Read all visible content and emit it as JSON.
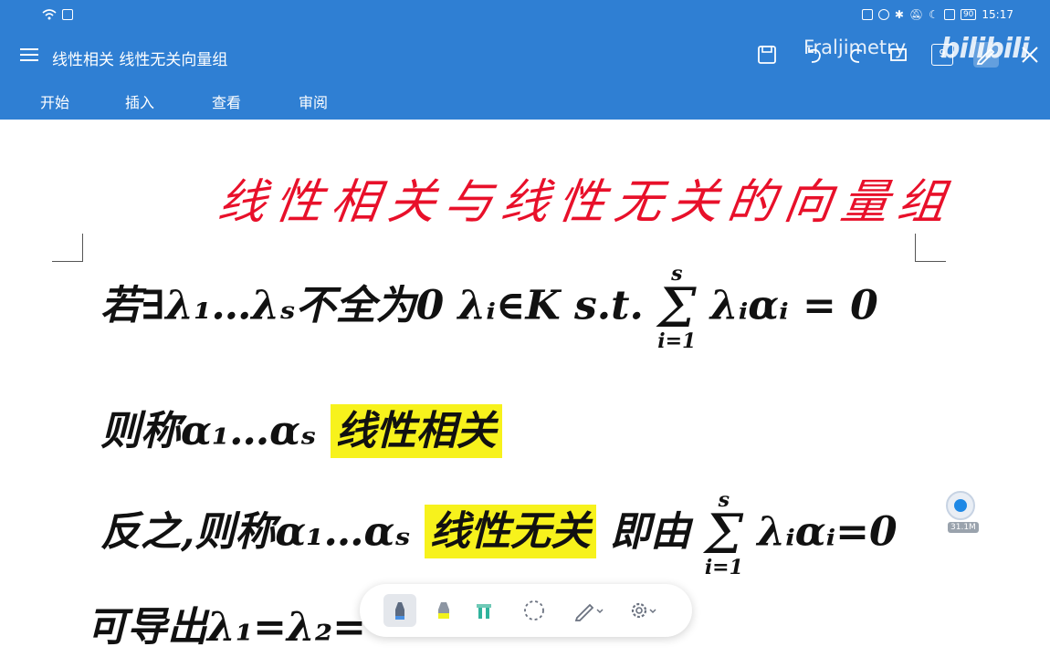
{
  "status_bar": {
    "time": "15:17",
    "battery": "90"
  },
  "title_bar": {
    "document_title": "线性相关 线性无关向量组",
    "page_count": "9",
    "watermark": "Fraljimetry",
    "watermark_logo": "bilibili"
  },
  "tabs": [
    {
      "label": "开始"
    },
    {
      "label": "插入"
    },
    {
      "label": "查看"
    },
    {
      "label": "审阅"
    }
  ],
  "notes": {
    "title": "线性相关与线性无关的向量组",
    "line1": {
      "text": "若∃λ₁…λₛ不全为0 λᵢ∈K  s.t.",
      "sum_top": "s",
      "sum_bottom": "i=1",
      "after": "λᵢαᵢ = 0"
    },
    "line2": {
      "text": "则称α₁…αₛ",
      "highlight": "线性相关"
    },
    "line3": {
      "text": "反之,则称α₁…αₛ",
      "highlight": "线性无关",
      "after": "即由",
      "sum_top": "s",
      "sum_bottom": "i=1",
      "tail": "λᵢαᵢ=0"
    },
    "line4": {
      "text": "可导出λ₁=λ₂="
    },
    "highlight_color": "#f7f21c",
    "title_color": "#e8102a"
  },
  "recording_badge": {
    "label": "31.1M"
  },
  "pen_toolbar": {
    "tools": [
      {
        "name": "pen",
        "active": true
      },
      {
        "name": "highlighter"
      },
      {
        "name": "eraser"
      },
      {
        "name": "lasso"
      },
      {
        "name": "pencil-options"
      },
      {
        "name": "settings"
      }
    ]
  },
  "colors": {
    "app_bar": "#2f7fd3"
  }
}
